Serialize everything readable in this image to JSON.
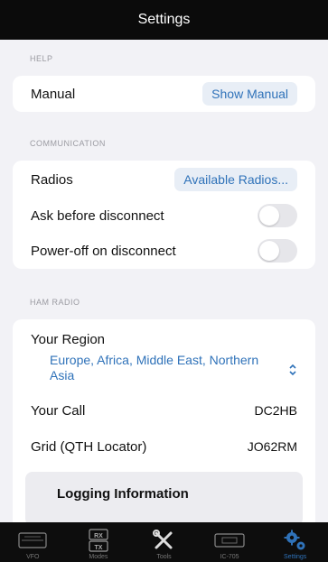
{
  "nav": {
    "title": "Settings"
  },
  "sections": {
    "help": {
      "header": "HELP",
      "manual_label": "Manual",
      "manual_button": "Show Manual"
    },
    "communication": {
      "header": "COMMUNICATION",
      "radios_label": "Radios",
      "radios_button": "Available Radios...",
      "ask_before_disconnect_label": "Ask before disconnect",
      "ask_before_disconnect_on": false,
      "power_off_label": "Power-off on disconnect",
      "power_off_on": false
    },
    "ham_radio": {
      "header": "HAM RADIO",
      "region_label": "Your Region",
      "region_value": "Europe, Africa, Middle East, Northern Asia",
      "call_label": "Your Call",
      "call_value": "DC2HB",
      "grid_label": "Grid (QTH Locator)",
      "grid_value": "JO62RM",
      "logging_label": "Logging Information"
    }
  },
  "tabbar": {
    "items": [
      {
        "label": "VFO",
        "icon": "vfo-icon",
        "active": false
      },
      {
        "label": "Modes",
        "icon": "rx-tx-icon",
        "active": false
      },
      {
        "label": "Tools",
        "icon": "tools-icon",
        "active": false
      },
      {
        "label": "IC-705",
        "icon": "radio-icon",
        "active": false
      },
      {
        "label": "Settings",
        "icon": "gears-icon",
        "active": true
      }
    ]
  },
  "colors": {
    "accent": "#2f72b9",
    "nav_bg": "#0b0b0b",
    "background": "#f2f2f6"
  }
}
